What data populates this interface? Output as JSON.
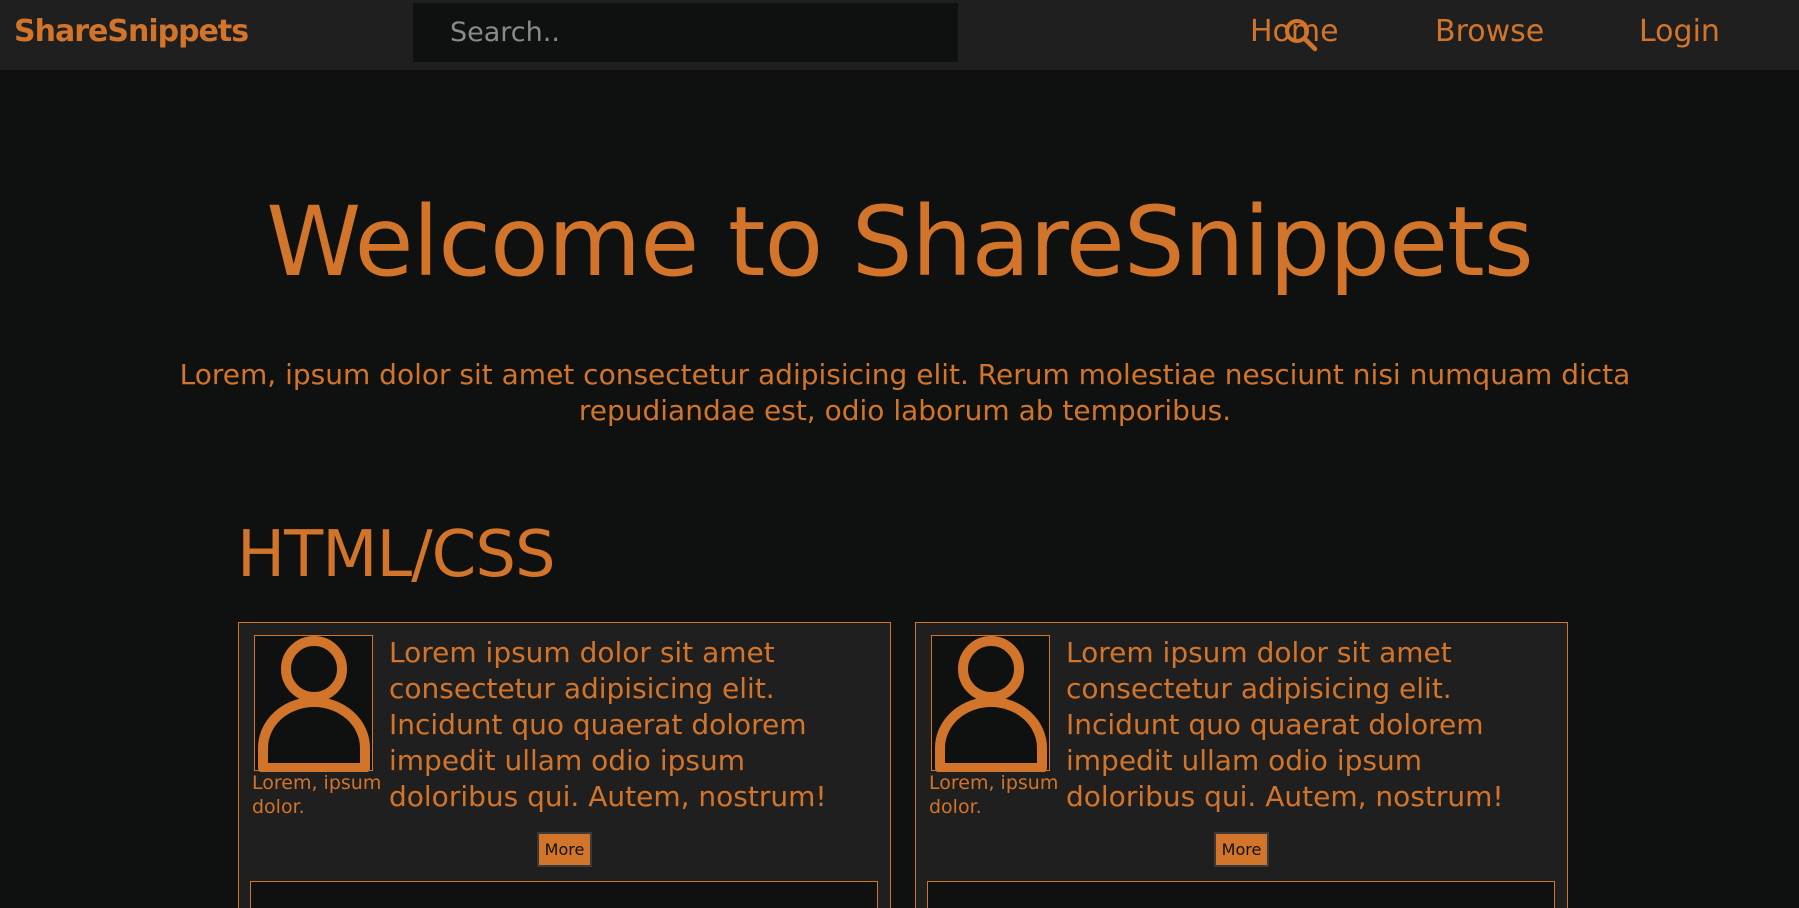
{
  "navbar": {
    "brand": "ShareSnippets",
    "search": {
      "placeholder": "Search..",
      "icon": "search-icon"
    },
    "links": [
      "Home",
      "Browse",
      "Login"
    ]
  },
  "hero": {
    "title": "Welcome to ShareSnippets",
    "subtitle": "Lorem, ipsum dolor sit amet consectetur adipisicing elit. Rerum molestiae nesciunt nisi numquam dicta repudiandae est, odio laborum ab temporibus."
  },
  "section": {
    "title": "HTML/CSS",
    "cards": [
      {
        "avatar_icon": "user-icon",
        "author": "Lorem, ipsum dolor.",
        "text": "Lorem ipsum dolor sit amet consectetur adipisicing elit. Incidunt quo quaerat dolorem impedit ullam odio ipsum doloribus qui. Autem, nostrum!",
        "button": "More"
      },
      {
        "avatar_icon": "user-icon",
        "author": "Lorem, ipsum dolor.",
        "text": "Lorem ipsum dolor sit amet consectetur adipisicing elit. Incidunt quo quaerat dolorem impedit ullam odio ipsum doloribus qui. Autem, nostrum!",
        "button": "More"
      }
    ]
  },
  "colors": {
    "accent": "#d2752b",
    "background": "#0f1110",
    "surface": "#1f1f1f"
  }
}
